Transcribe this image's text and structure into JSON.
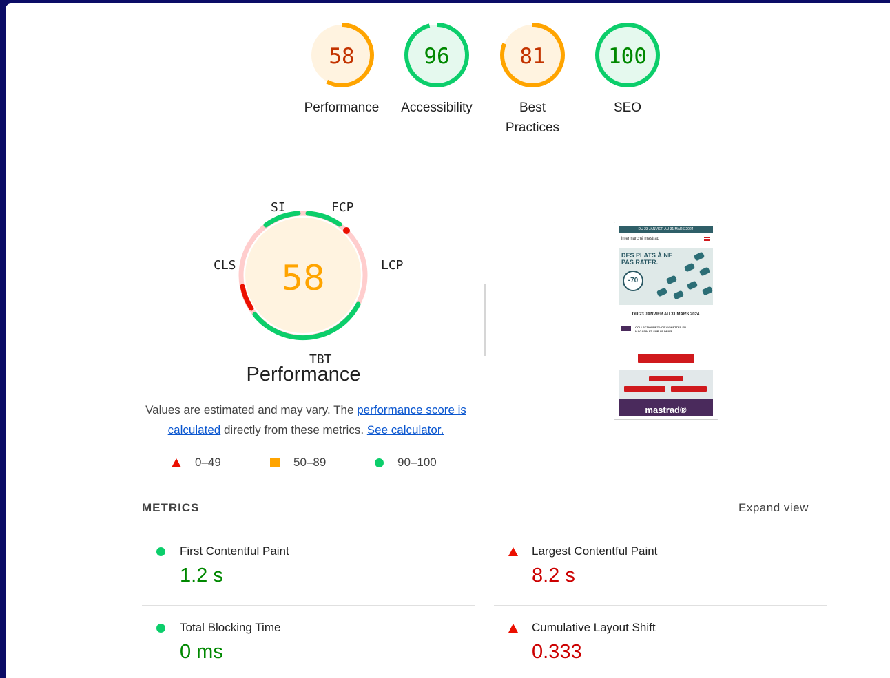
{
  "gauges": [
    {
      "score": "58",
      "label": "Performance",
      "level": 0.58,
      "color": "#ffa400",
      "bg": "#fff3e0",
      "text": "#c33300"
    },
    {
      "score": "96",
      "label": "Accessibility",
      "level": 0.96,
      "color": "#0cce6b",
      "bg": "#e5f9ee",
      "text": "#008800"
    },
    {
      "score": "81",
      "label": "Best Practices",
      "level": 0.81,
      "color": "#ffa400",
      "bg": "#fff3e0",
      "text": "#c33300"
    },
    {
      "score": "100",
      "label": "SEO",
      "level": 1.0,
      "color": "#0cce6b",
      "bg": "#e5f9ee",
      "text": "#008800"
    }
  ],
  "performance": {
    "score": "58",
    "title": "Performance",
    "metric_tags": {
      "si": "SI",
      "fcp": "FCP",
      "lcp": "LCP",
      "tbt": "TBT",
      "cls": "CLS"
    },
    "description_1": "Values are estimated and may vary. The ",
    "link_score": "performance score is calculated",
    "description_2": " directly from these metrics. ",
    "link_calc": "See calculator.",
    "legend": {
      "fail": "0–49",
      "average": "50–89",
      "pass": "90–100"
    }
  },
  "thumbnail": {
    "banner": "DU 23 JANVIER AU 31 MARS 2024",
    "logos": "intermarché   mastrad",
    "hero_line1": "DES PLATS À NE",
    "hero_line2": "PAS RATER.",
    "badge": "-70",
    "date": "DU 23 JANVIER AU 31 MARS 2024",
    "info": "COLLECTIONNEZ VOS VIGNETTES EN MAGASIN ET SUR LE DRIVE.",
    "footer": "mastrad®"
  },
  "metrics": {
    "title": "METRICS",
    "expand": "Expand view",
    "items": [
      {
        "label": "First Contentful Paint",
        "value": "1.2 s",
        "status": "pass"
      },
      {
        "label": "Largest Contentful Paint",
        "value": "8.2 s",
        "status": "fail"
      },
      {
        "label": "Total Blocking Time",
        "value": "0 ms",
        "status": "pass"
      },
      {
        "label": "Cumulative Layout Shift",
        "value": "0.333",
        "status": "fail"
      }
    ]
  }
}
